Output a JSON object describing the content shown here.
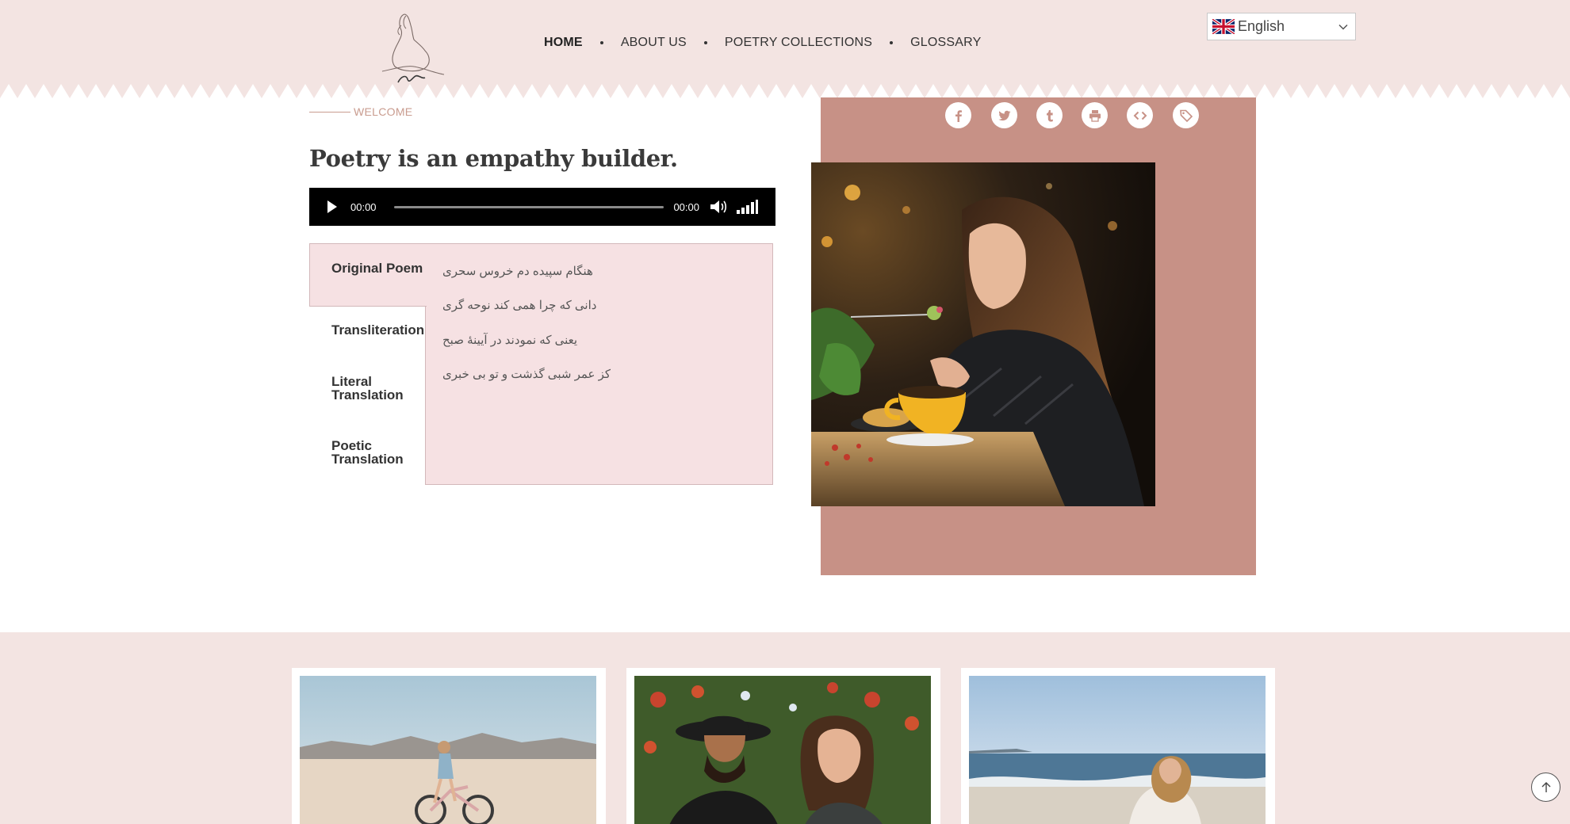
{
  "header": {
    "nav": [
      {
        "label": "HOME",
        "active": true
      },
      {
        "label": "ABOUT US",
        "active": false
      },
      {
        "label": "POETRY COLLECTIONS",
        "active": false
      },
      {
        "label": "GLOSSARY",
        "active": false
      }
    ],
    "language": {
      "selected": "English",
      "flag_icon": "uk-flag-icon"
    }
  },
  "welcome": {
    "label": "WELCOME",
    "headline": "Poetry is an empathy builder."
  },
  "audio_player": {
    "current_time": "00:00",
    "duration": "00:00",
    "progress": 0
  },
  "poem_tabs": {
    "tabs": [
      {
        "label": "Original Poem",
        "active": true
      },
      {
        "label": "Transliteration",
        "active": false
      },
      {
        "label": "Literal Translation",
        "active": false
      },
      {
        "label": "Poetic Translation",
        "active": false
      }
    ],
    "lines": [
      "هنگام سپیده دم خروس سحری",
      "دانی که چرا همی کند نوحه گری",
      "یعنی که نمودند در آیینهٔ صبح",
      "کز عمر شبی گذشت و تو بی خبری"
    ]
  },
  "share": {
    "icons": [
      "facebook-icon",
      "twitter-icon",
      "tumblr-icon",
      "print-icon",
      "embed-icon",
      "tag-icon"
    ]
  },
  "colors": {
    "header_bg": "#f3e4e2",
    "accent": "#c79186",
    "tab_panel_bg": "#f6e1e3",
    "welcome_text": "#c99c8f"
  }
}
